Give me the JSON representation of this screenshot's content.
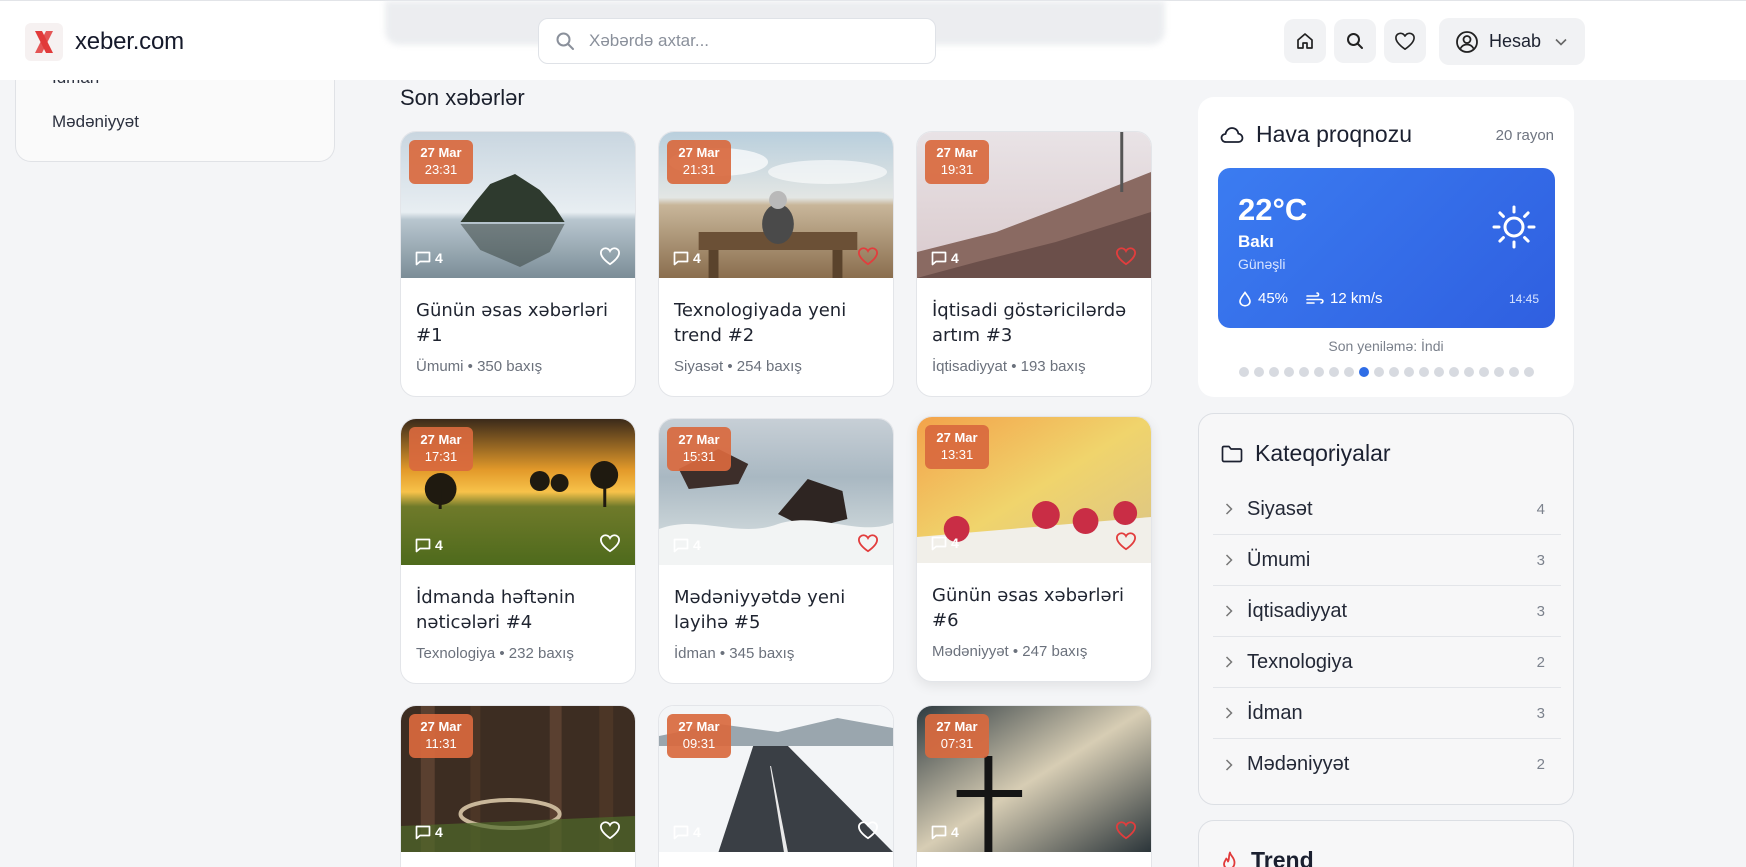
{
  "header": {
    "site_name": "xeber.com",
    "search_placeholder": "Xəbərdə axtar...",
    "account_label": "Hesab"
  },
  "sidebar": {
    "items": [
      "İdman",
      "Mədəniyyət"
    ]
  },
  "section_title": "Son xəbərlər",
  "articles": [
    {
      "date": "27 Mar",
      "time": "23:31",
      "comments": "4",
      "title": "Günün əsas xəbərləri #1",
      "meta": "Ümumi • 350 baxış",
      "favorited": false
    },
    {
      "date": "27 Mar",
      "time": "21:31",
      "comments": "4",
      "title": "Texnologiyada yeni trend #2",
      "meta": "Siyasət • 254 baxış",
      "favorited": true
    },
    {
      "date": "27 Mar",
      "time": "19:31",
      "comments": "4",
      "title": "İqtisadi göstəricilərdə artım #3",
      "meta": "İqtisadiyyat • 193 baxış",
      "favorited": true
    },
    {
      "date": "27 Mar",
      "time": "17:31",
      "comments": "4",
      "title": "İdmanda həftənin nəticələri #4",
      "meta": "Texnologiya • 232 baxış",
      "favorited": false
    },
    {
      "date": "27 Mar",
      "time": "15:31",
      "comments": "4",
      "title": "Mədəniyyətdə yeni layihə #5",
      "meta": "İdman • 345 baxış",
      "favorited": true
    },
    {
      "date": "27 Mar",
      "time": "13:31",
      "comments": "4",
      "title": "Günün əsas xəbərləri #6",
      "meta": "Mədəniyyət • 247 baxış",
      "favorited": true
    },
    {
      "date": "27 Mar",
      "time": "11:31",
      "comments": "4",
      "title": "",
      "meta": "",
      "favorited": false
    },
    {
      "date": "27 Mar",
      "time": "09:31",
      "comments": "4",
      "title": "",
      "meta": "",
      "favorited": false
    },
    {
      "date": "27 Mar",
      "time": "07:31",
      "comments": "4",
      "title": "",
      "meta": "",
      "favorited": true
    }
  ],
  "weather": {
    "title": "Hava proqnozu",
    "region_count": "20 rayon",
    "temperature": "22°C",
    "city": "Bakı",
    "condition": "Günəşli",
    "humidity": "45%",
    "wind": "12 km/s",
    "time": "14:45",
    "updated": "Son yeniləmə: İndi",
    "slides_total": 20,
    "slide_active": 8
  },
  "categories": {
    "title": "Kateqoriyalar",
    "items": [
      {
        "name": "Siyasət",
        "count": "4"
      },
      {
        "name": "Ümumi",
        "count": "3"
      },
      {
        "name": "İqtisadiyyat",
        "count": "3"
      },
      {
        "name": "Texnologiya",
        "count": "2"
      },
      {
        "name": "İdman",
        "count": "3"
      },
      {
        "name": "Mədəniyyət",
        "count": "2"
      }
    ]
  },
  "trend": {
    "title": "Trend"
  },
  "colors": {
    "accent": "#2f6de6",
    "badge": "#d9693e",
    "favorite": "#e23d3d"
  }
}
